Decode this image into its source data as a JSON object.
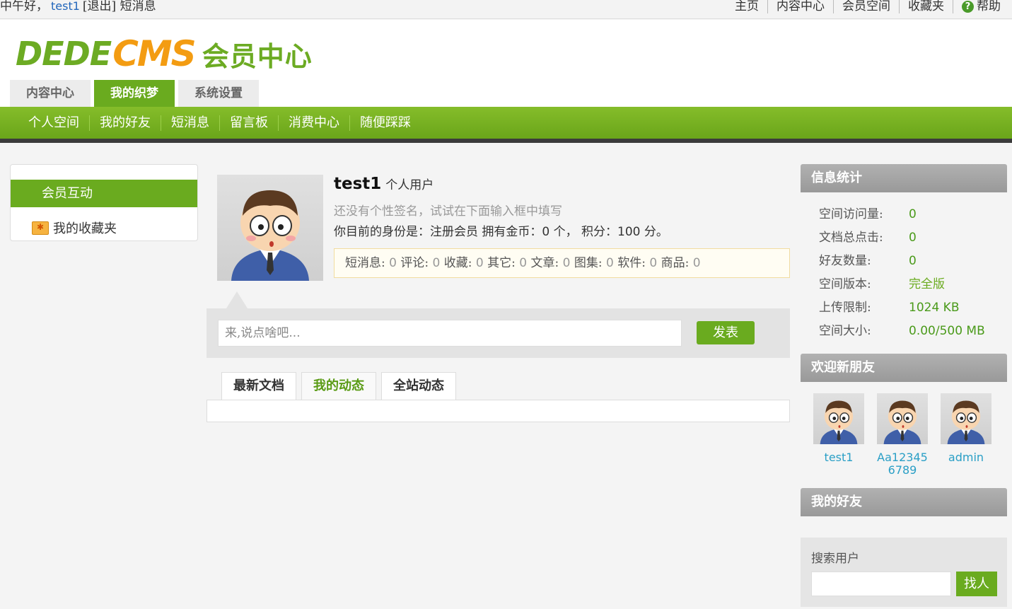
{
  "topbar": {
    "greeting": "中午好，",
    "username": "test1",
    "logout": "[退出]",
    "messages": "短消息",
    "links": [
      "主页",
      "内容中心",
      "会员空间",
      "收藏夹"
    ],
    "help": "帮助"
  },
  "logo": {
    "dede": "DEDE",
    "cms": "CMS",
    "member_center": "会员中心"
  },
  "main_tabs": [
    "内容中心",
    "我的织梦",
    "系统设置"
  ],
  "main_tab_active": "我的织梦",
  "nav": [
    "个人空间",
    "我的好友",
    "短消息",
    "留言板",
    "消费中心",
    "随便踩踩"
  ],
  "sidebar": {
    "active_item": "会员互动",
    "item": "我的收藏夹"
  },
  "profile": {
    "name": "test1",
    "type": "个人用户",
    "signature": "还没有个性签名，试试在下面输入框中填写",
    "identity_prefix": "你目前的身份是：注册会员 拥有金币：",
    "coins": "0",
    "identity_mid": " 个， 积分：",
    "score": "100",
    "identity_suffix": " 分。"
  },
  "stats": [
    {
      "label": "短消息:",
      "value": "0"
    },
    {
      "label": "评论:",
      "value": "0"
    },
    {
      "label": "收藏:",
      "value": "0"
    },
    {
      "label": "其它:",
      "value": "0"
    },
    {
      "label": "文章:",
      "value": "0"
    },
    {
      "label": "图集:",
      "value": "0"
    },
    {
      "label": "软件:",
      "value": "0"
    },
    {
      "label": "商品:",
      "value": "0"
    }
  ],
  "post": {
    "placeholder": "来,说点啥吧...",
    "button": "发表"
  },
  "content_tabs": [
    "最新文档",
    "我的动态",
    "全站动态"
  ],
  "content_tab_active": "我的动态",
  "info": {
    "title": "信息统计",
    "rows": [
      {
        "label": "空间访问量:",
        "value": "0"
      },
      {
        "label": "文档总点击:",
        "value": "0"
      },
      {
        "label": "好友数量:",
        "value": "0"
      },
      {
        "label": "空间版本:",
        "value": "完全版"
      },
      {
        "label": "上传限制:",
        "value": "1024 KB"
      },
      {
        "label": "空间大小:",
        "value": "0.00/500 MB"
      }
    ]
  },
  "new_friends": {
    "title": "欢迎新朋友",
    "users": [
      "test1",
      "Aa123456789",
      "admin"
    ]
  },
  "my_friends": {
    "title": "我的好友"
  },
  "search": {
    "label": "搜索用户",
    "button": "找人",
    "value": ""
  },
  "colors": {
    "green": "#6aab1f",
    "orange": "#f39c12",
    "link_blue": "#2a9fc6"
  }
}
